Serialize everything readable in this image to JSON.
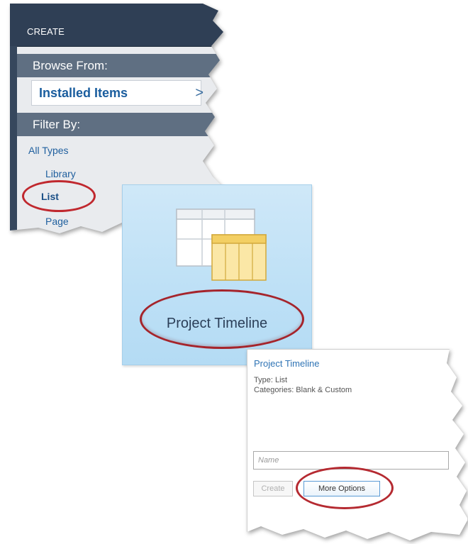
{
  "create_panel": {
    "title": "CREATE",
    "browse_heading": "Browse From:",
    "installed_items": "Installed Items",
    "installed_chevron": ">",
    "filter_heading": "Filter By:",
    "filters": [
      "All Types",
      "Library",
      "List",
      "Page"
    ],
    "selected_filter": "List"
  },
  "tile": {
    "label": "Project Timeline",
    "icon": "list-table-icon"
  },
  "details": {
    "title": "Project Timeline",
    "type": "Type: List",
    "categories": "Categories: Blank & Custom",
    "name_placeholder": "Name",
    "create_label": "Create",
    "more_options_label": "More Options"
  },
  "colors": {
    "header_bg": "#2f3f55",
    "section_bar": "#5f6f82",
    "link_blue": "#1f5f9e",
    "highlight_red": "#c0282e",
    "tile_blue": "#bde0f6"
  }
}
